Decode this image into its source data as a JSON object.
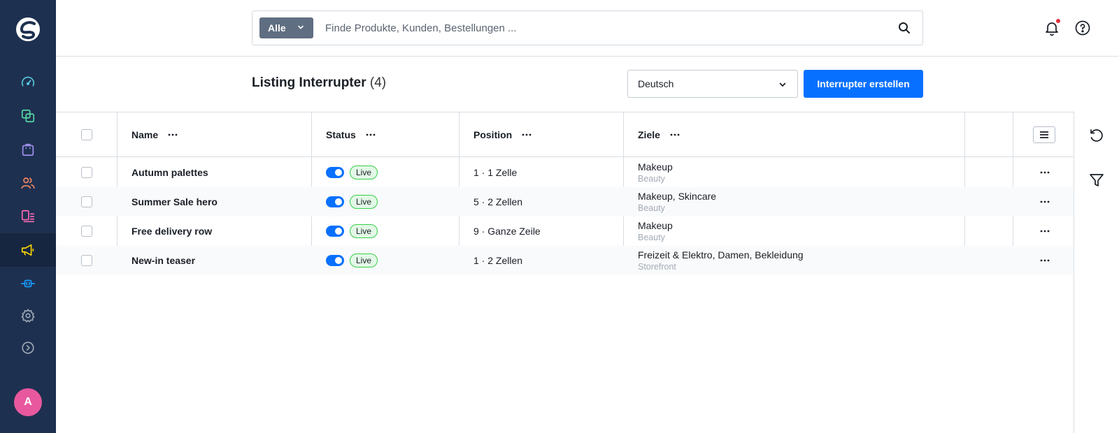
{
  "sidebar": {
    "logo": "shopware-logo",
    "items": [
      {
        "icon": "dashboard-gauge-icon",
        "color": "#59c9e0"
      },
      {
        "icon": "catalogues-icon",
        "color": "#57d9a3"
      },
      {
        "icon": "orders-bag-icon",
        "color": "#a092f0"
      },
      {
        "icon": "customers-icon",
        "color": "#f88962"
      },
      {
        "icon": "content-icon",
        "color": "#ff68b4"
      },
      {
        "icon": "marketing-megaphone-icon",
        "color": "#ffd700",
        "active": true
      },
      {
        "icon": "extensions-plug-icon",
        "color": "#189eff"
      },
      {
        "icon": "settings-gear-icon",
        "color": "#9aa8b5"
      },
      {
        "icon": "expand-chevron-icon",
        "color": "#9aa8b5"
      }
    ],
    "avatar_initial": "A"
  },
  "search": {
    "type_label": "Alle",
    "placeholder": "Finde Produkte, Kunden, Bestellungen ..."
  },
  "header": {
    "title": "Listing Interrupter",
    "count": "(4)",
    "language": "Deutsch",
    "create_label": "Interrupter erstellen"
  },
  "table": {
    "columns": [
      "Name",
      "Status",
      "Position",
      "Ziele"
    ],
    "rows": [
      {
        "name": "Autumn palettes",
        "status": "Live",
        "position": "1 · 1 Zelle",
        "targets": "Makeup",
        "target_group": "Beauty"
      },
      {
        "name": "Summer Sale hero",
        "status": "Live",
        "position": "5 · 2 Zellen",
        "targets": "Makeup, Skincare",
        "target_group": "Beauty"
      },
      {
        "name": "Free delivery row",
        "status": "Live",
        "position": "9 · Ganze Zeile",
        "targets": "Makeup",
        "target_group": "Beauty"
      },
      {
        "name": "New-in teaser",
        "status": "Live",
        "position": "1 · 2 Zellen",
        "targets": "Freizeit & Elektro, Damen, Bekleidung",
        "target_group": "Storefront"
      }
    ]
  },
  "colors": {
    "sidebar_bg": "#1e3050",
    "primary": "#0870ff",
    "live_badge_bg": "#e3f8e7",
    "live_badge_border": "#37d046"
  }
}
